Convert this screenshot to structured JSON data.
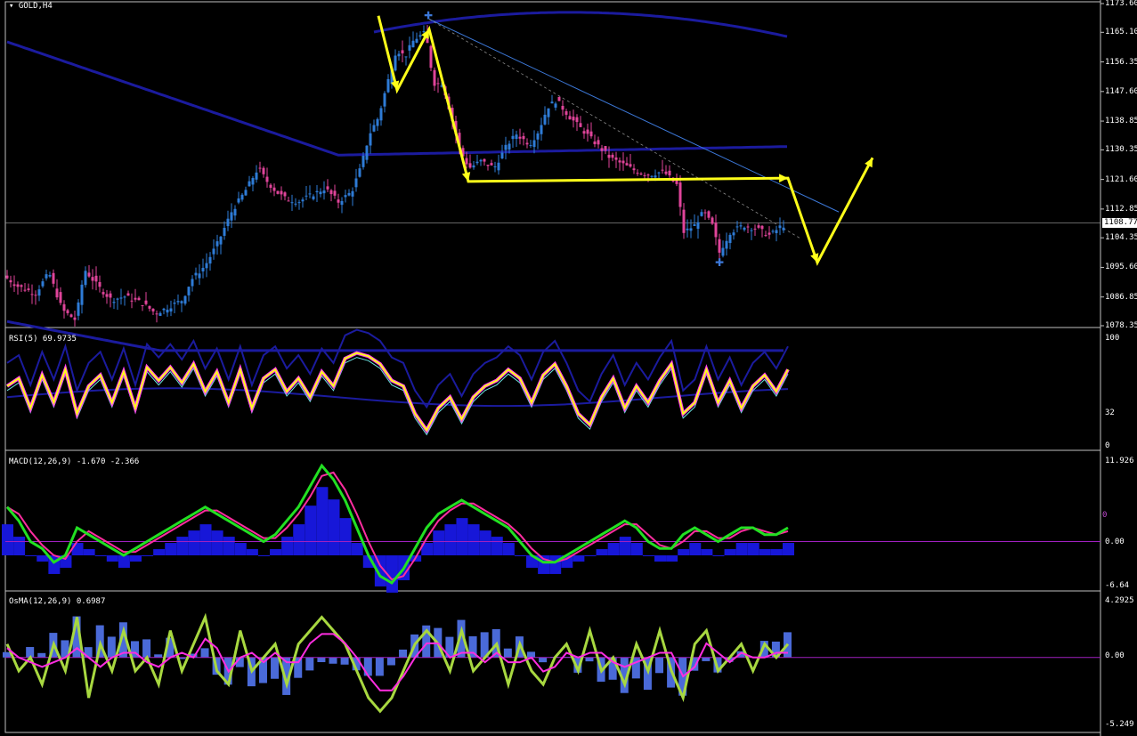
{
  "symbol_label": "GOLD,H4",
  "current_price": "1108.77",
  "colors": {
    "background": "#000000",
    "frame": "#c0c0c0",
    "bull_candle": "#2e7bd6",
    "bear_candle": "#e0449a",
    "envelope": "#1b1b9e",
    "arrows": "#ffff1a"
  },
  "main_price_axis": [
    "1173.60",
    "1165.10",
    "1156.35",
    "1147.60",
    "1138.85",
    "1130.35",
    "1121.60",
    "1112.85",
    "1104.35",
    "1095.60",
    "1086.85",
    "1078.35"
  ],
  "rsi": {
    "label": "RSI(5) 69.9735",
    "axis": [
      "100",
      "32",
      "0"
    ]
  },
  "macd": {
    "label": "MACD(12,26,9) -1.670 -2.366",
    "axis": [
      "11.926",
      "0.00",
      "-6.64"
    ],
    "zero_marker": "0"
  },
  "osma": {
    "label": "OsMA(12,26,9) 0.6987",
    "axis": [
      "4.2925",
      "0.00",
      "-5.249"
    ]
  },
  "chart_data": [
    {
      "type": "candlestick",
      "title": "GOLD,H4",
      "ylim": [
        1078.35,
        1173.6
      ],
      "price_line": 1108.77,
      "close_path": [
        [
          0,
          1094
        ],
        [
          20,
          1090
        ],
        [
          40,
          1088
        ],
        [
          55,
          1094
        ],
        [
          70,
          1083
        ],
        [
          85,
          1080
        ],
        [
          95,
          1095
        ],
        [
          110,
          1090
        ],
        [
          125,
          1086
        ],
        [
          140,
          1087
        ],
        [
          160,
          1085
        ],
        [
          175,
          1082
        ],
        [
          190,
          1084
        ],
        [
          205,
          1086
        ],
        [
          215,
          1092
        ],
        [
          230,
          1096
        ],
        [
          245,
          1103
        ],
        [
          260,
          1112
        ],
        [
          275,
          1118
        ],
        [
          290,
          1125
        ],
        [
          300,
          1121
        ],
        [
          310,
          1118
        ],
        [
          320,
          1116
        ],
        [
          335,
          1115
        ],
        [
          350,
          1117
        ],
        [
          365,
          1119
        ],
        [
          380,
          1115
        ],
        [
          395,
          1118
        ],
        [
          405,
          1125
        ],
        [
          415,
          1135
        ],
        [
          425,
          1140
        ],
        [
          435,
          1150
        ],
        [
          445,
          1160
        ],
        [
          455,
          1158
        ],
        [
          465,
          1163
        ],
        [
          478,
          1165
        ],
        [
          487,
          1150
        ],
        [
          497,
          1150
        ],
        [
          507,
          1140
        ],
        [
          517,
          1130
        ],
        [
          527,
          1125
        ],
        [
          540,
          1127
        ],
        [
          555,
          1125
        ],
        [
          570,
          1132
        ],
        [
          580,
          1135
        ],
        [
          595,
          1132
        ],
        [
          605,
          1136
        ],
        [
          615,
          1143
        ],
        [
          625,
          1145
        ],
        [
          640,
          1140
        ],
        [
          655,
          1136
        ],
        [
          670,
          1132
        ],
        [
          685,
          1128
        ],
        [
          700,
          1126
        ],
        [
          715,
          1124
        ],
        [
          730,
          1123
        ],
        [
          745,
          1124
        ],
        [
          760,
          1120
        ],
        [
          768,
          1106
        ],
        [
          780,
          1108
        ],
        [
          790,
          1112
        ],
        [
          800,
          1108
        ],
        [
          808,
          1100
        ],
        [
          820,
          1106
        ],
        [
          835,
          1108
        ],
        [
          850,
          1107
        ],
        [
          865,
          1105
        ],
        [
          878,
          1108
        ]
      ],
      "arrow_path": [
        [
          425,
          1170
        ],
        [
          446,
          1148
        ],
        [
          482,
          1166
        ],
        [
          526,
          1121
        ],
        [
          885,
          1122
        ],
        [
          918,
          1097
        ],
        [
          980,
          1128
        ]
      ]
    },
    {
      "type": "line",
      "title": "RSI(5) 69.9735",
      "ylim": [
        0,
        100
      ],
      "series": [
        {
          "name": "RSI(5)",
          "values": [
            55,
            62,
            35,
            65,
            40,
            70,
            30,
            55,
            65,
            40,
            68,
            35,
            72,
            60,
            72,
            58,
            75,
            50,
            68,
            40,
            70,
            35,
            62,
            70,
            50,
            62,
            45,
            68,
            55,
            80,
            85,
            82,
            75,
            60,
            55,
            30,
            15,
            35,
            45,
            25,
            45,
            55,
            60,
            70,
            62,
            40,
            65,
            75,
            55,
            30,
            20,
            45,
            62,
            35,
            55,
            40,
            60,
            75,
            30,
            40,
            70,
            40,
            60,
            35,
            55,
            65,
            50,
            70
          ]
        }
      ]
    },
    {
      "type": "line",
      "title": "MACD(12,26,9) -1.670 -2.366",
      "ylim": [
        -6.64,
        11.926
      ],
      "series": [
        {
          "name": "MACD(12,26,9)",
          "values": [
            5,
            3,
            0,
            -1,
            -3,
            -2,
            2,
            1,
            0,
            -1,
            -2,
            -1,
            0,
            1,
            2,
            3,
            4,
            5,
            4,
            3,
            2,
            1,
            0,
            1,
            3,
            5,
            8,
            11,
            9,
            6,
            2,
            -2,
            -5,
            -6,
            -4,
            -1,
            2,
            4,
            5,
            6,
            5,
            4,
            3,
            2,
            0,
            -2,
            -3,
            -3,
            -2,
            -1,
            0,
            1,
            2,
            3,
            2,
            0,
            -1,
            -1,
            1,
            2,
            1,
            0,
            1,
            2,
            2,
            1,
            1,
            2
          ]
        }
      ]
    },
    {
      "type": "line",
      "title": "OsMA(12,26,9) 0.6987",
      "ylim": [
        -5.249,
        4.2925
      ],
      "series": [
        {
          "name": "OsMA(12,26,9)",
          "values": [
            1,
            -1,
            0,
            -2,
            1,
            -1,
            3,
            -3,
            1,
            -1,
            2,
            -1,
            0,
            -2,
            2,
            -1,
            1,
            3,
            -1,
            -2,
            2,
            -1,
            0,
            1,
            -2,
            1,
            2,
            3,
            2,
            1,
            -1,
            -3,
            -4,
            -3,
            -1,
            1,
            2,
            1,
            -1,
            2,
            -1,
            0,
            1,
            -2,
            1,
            -1,
            -2,
            0,
            1,
            -1,
            2,
            -1,
            0,
            -2,
            1,
            -1,
            2,
            -1,
            -3,
            1,
            2,
            -1,
            0,
            1,
            -1,
            1,
            0,
            1
          ]
        }
      ]
    }
  ]
}
